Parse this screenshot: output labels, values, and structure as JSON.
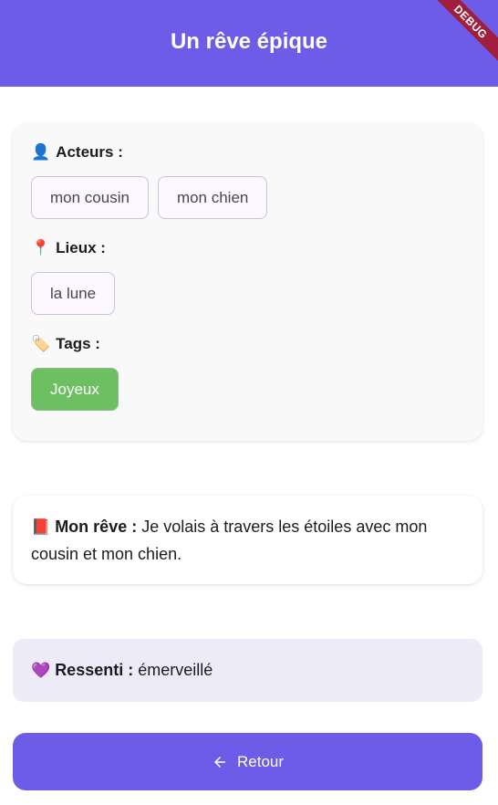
{
  "appbar": {
    "title": "Un rêve épique",
    "debug_label": "DEBUG"
  },
  "actors": {
    "icon": "👤",
    "label": "Acteurs :",
    "items": [
      "mon cousin",
      "mon chien"
    ]
  },
  "places": {
    "icon": "📍",
    "label": "Lieux :",
    "items": [
      "la lune"
    ]
  },
  "tags": {
    "icon": "🏷️",
    "label": "Tags :",
    "items": [
      "Joyeux"
    ],
    "tag_color": "#6cc062"
  },
  "dream": {
    "icon": "📕",
    "label": "Mon rêve :",
    "text": " Je volais à travers les étoiles avec mon cousin et mon chien."
  },
  "feeling": {
    "icon": "💜",
    "label": "Ressenti :",
    "text": " émerveillé"
  },
  "back_button": {
    "label": "Retour",
    "icon": "arrow-left-icon"
  },
  "colors": {
    "primary": "#6c5ce7",
    "feeling_bg": "#eeebf9",
    "card_bg": "#faf9fa"
  }
}
